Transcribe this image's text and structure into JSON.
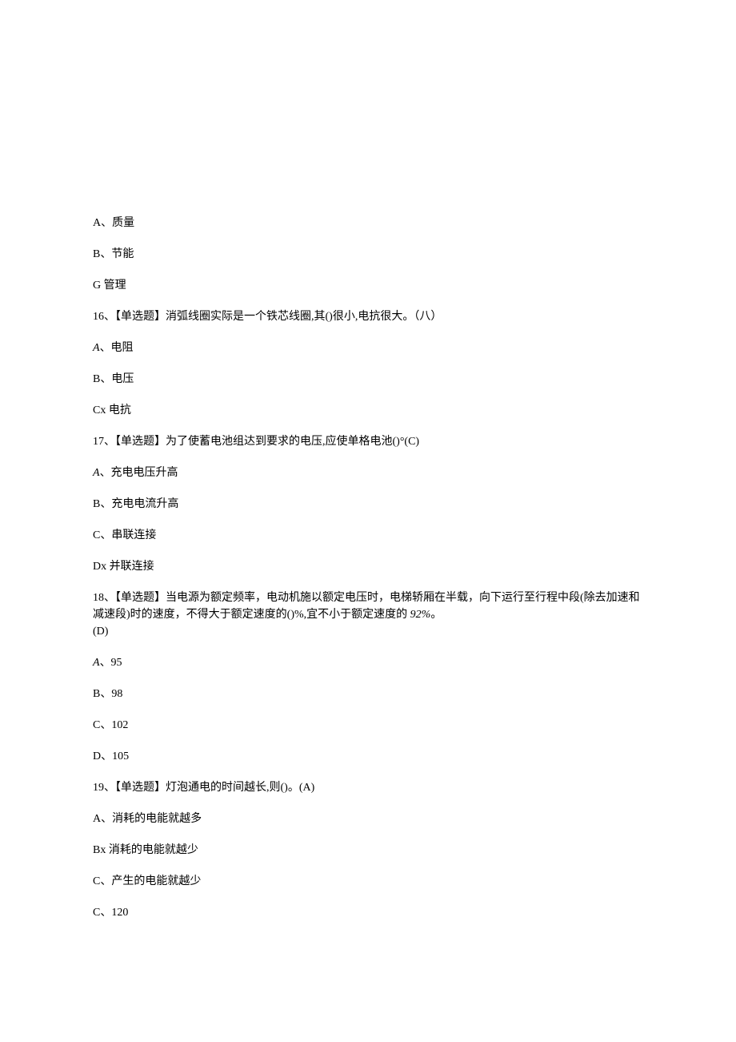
{
  "q15": {
    "options": {
      "a": "A、质量",
      "b": "B、节能",
      "c": "G 管理"
    }
  },
  "q16": {
    "stem": "16、【单选题】消弧线圈实际是一个铁芯线圈,其()很小,电抗很大。（八）",
    "options": {
      "a_prefix": "A",
      "a_text": "、电阻",
      "b": "B、电压",
      "c": "Cx 电抗"
    }
  },
  "q17": {
    "stem": "17、【单选题】为了使蓄电池组达到要求的电压,应使单格电池()°(C)",
    "options": {
      "a_prefix": "A",
      "a_text": "、充电电压升高",
      "b": "B、充电电流升高",
      "c": "C、串联连接",
      "d": "Dx 并联连接"
    }
  },
  "q18": {
    "stem_part1": "18、【单选题】当电源为额定频率，电动机施以额定电压时，电梯轿厢在半载，向下运行至行程中段(除去加速和减速段)时的速度，不得大于额定速度的()%,宜不小于额定速度的 ",
    "stem_italic": "92%",
    "stem_end": "。",
    "stem_answer": "(D)",
    "options": {
      "a_prefix": "A",
      "a_text": "、95",
      "b": "B、98",
      "c": "C、102",
      "d": "D、105"
    }
  },
  "q19": {
    "stem": "19、【单选题】灯泡通电的时间越长,则()。(A)",
    "options": {
      "a": "A、消耗的电能就越多",
      "b": "Bx 消耗的电能就越少",
      "c": "C、产生的电能就越少",
      "extra": "C、120"
    }
  }
}
